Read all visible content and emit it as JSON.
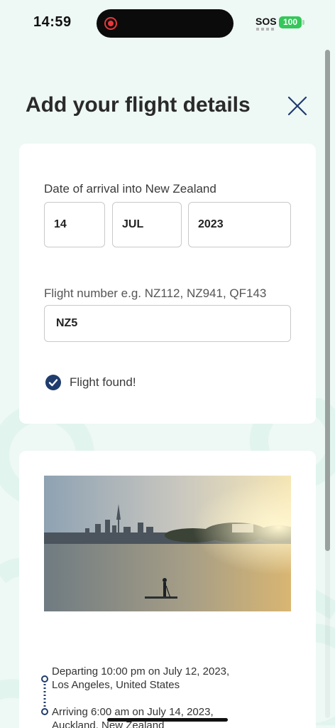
{
  "status_bar": {
    "time": "14:59",
    "carrier": "SOS",
    "battery": "100"
  },
  "header": {
    "title": "Add your flight details"
  },
  "form": {
    "date_label": "Date of arrival into New Zealand",
    "day": "14",
    "month": "JUL",
    "year": "2023",
    "flight_label": "Flight number e.g. NZ112, NZ941, QF143",
    "flight_number": "NZ5",
    "found_message": "Flight found!"
  },
  "flight": {
    "departure_line1": "Departing 10:00 pm on July 12, 2023,",
    "departure_line2": "Los Angeles, United States",
    "arrival_line1": "Arriving 6:00 am on July 14, 2023,",
    "arrival_line2": "Auckland, New Zealand"
  },
  "icons": {
    "close": "close-icon",
    "check": "check-circle-icon",
    "record": "screen-record-icon"
  },
  "colors": {
    "background": "#eef8f5",
    "accent": "#1f3c6d",
    "battery": "#34c759",
    "recording": "#e5383b"
  }
}
